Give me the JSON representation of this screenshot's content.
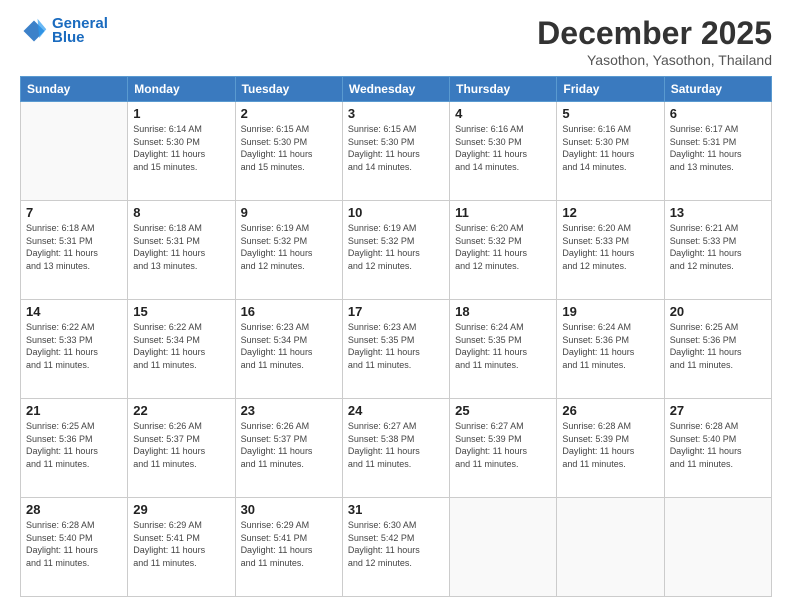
{
  "logo": {
    "line1": "General",
    "line2": "Blue"
  },
  "title": "December 2025",
  "subtitle": "Yasothon, Yasothon, Thailand",
  "days_header": [
    "Sunday",
    "Monday",
    "Tuesday",
    "Wednesday",
    "Thursday",
    "Friday",
    "Saturday"
  ],
  "weeks": [
    [
      {
        "day": "",
        "info": ""
      },
      {
        "day": "1",
        "info": "Sunrise: 6:14 AM\nSunset: 5:30 PM\nDaylight: 11 hours\nand 15 minutes."
      },
      {
        "day": "2",
        "info": "Sunrise: 6:15 AM\nSunset: 5:30 PM\nDaylight: 11 hours\nand 15 minutes."
      },
      {
        "day": "3",
        "info": "Sunrise: 6:15 AM\nSunset: 5:30 PM\nDaylight: 11 hours\nand 14 minutes."
      },
      {
        "day": "4",
        "info": "Sunrise: 6:16 AM\nSunset: 5:30 PM\nDaylight: 11 hours\nand 14 minutes."
      },
      {
        "day": "5",
        "info": "Sunrise: 6:16 AM\nSunset: 5:30 PM\nDaylight: 11 hours\nand 14 minutes."
      },
      {
        "day": "6",
        "info": "Sunrise: 6:17 AM\nSunset: 5:31 PM\nDaylight: 11 hours\nand 13 minutes."
      }
    ],
    [
      {
        "day": "7",
        "info": "Sunrise: 6:18 AM\nSunset: 5:31 PM\nDaylight: 11 hours\nand 13 minutes."
      },
      {
        "day": "8",
        "info": "Sunrise: 6:18 AM\nSunset: 5:31 PM\nDaylight: 11 hours\nand 13 minutes."
      },
      {
        "day": "9",
        "info": "Sunrise: 6:19 AM\nSunset: 5:32 PM\nDaylight: 11 hours\nand 12 minutes."
      },
      {
        "day": "10",
        "info": "Sunrise: 6:19 AM\nSunset: 5:32 PM\nDaylight: 11 hours\nand 12 minutes."
      },
      {
        "day": "11",
        "info": "Sunrise: 6:20 AM\nSunset: 5:32 PM\nDaylight: 11 hours\nand 12 minutes."
      },
      {
        "day": "12",
        "info": "Sunrise: 6:20 AM\nSunset: 5:33 PM\nDaylight: 11 hours\nand 12 minutes."
      },
      {
        "day": "13",
        "info": "Sunrise: 6:21 AM\nSunset: 5:33 PM\nDaylight: 11 hours\nand 12 minutes."
      }
    ],
    [
      {
        "day": "14",
        "info": "Sunrise: 6:22 AM\nSunset: 5:33 PM\nDaylight: 11 hours\nand 11 minutes."
      },
      {
        "day": "15",
        "info": "Sunrise: 6:22 AM\nSunset: 5:34 PM\nDaylight: 11 hours\nand 11 minutes."
      },
      {
        "day": "16",
        "info": "Sunrise: 6:23 AM\nSunset: 5:34 PM\nDaylight: 11 hours\nand 11 minutes."
      },
      {
        "day": "17",
        "info": "Sunrise: 6:23 AM\nSunset: 5:35 PM\nDaylight: 11 hours\nand 11 minutes."
      },
      {
        "day": "18",
        "info": "Sunrise: 6:24 AM\nSunset: 5:35 PM\nDaylight: 11 hours\nand 11 minutes."
      },
      {
        "day": "19",
        "info": "Sunrise: 6:24 AM\nSunset: 5:36 PM\nDaylight: 11 hours\nand 11 minutes."
      },
      {
        "day": "20",
        "info": "Sunrise: 6:25 AM\nSunset: 5:36 PM\nDaylight: 11 hours\nand 11 minutes."
      }
    ],
    [
      {
        "day": "21",
        "info": "Sunrise: 6:25 AM\nSunset: 5:36 PM\nDaylight: 11 hours\nand 11 minutes."
      },
      {
        "day": "22",
        "info": "Sunrise: 6:26 AM\nSunset: 5:37 PM\nDaylight: 11 hours\nand 11 minutes."
      },
      {
        "day": "23",
        "info": "Sunrise: 6:26 AM\nSunset: 5:37 PM\nDaylight: 11 hours\nand 11 minutes."
      },
      {
        "day": "24",
        "info": "Sunrise: 6:27 AM\nSunset: 5:38 PM\nDaylight: 11 hours\nand 11 minutes."
      },
      {
        "day": "25",
        "info": "Sunrise: 6:27 AM\nSunset: 5:39 PM\nDaylight: 11 hours\nand 11 minutes."
      },
      {
        "day": "26",
        "info": "Sunrise: 6:28 AM\nSunset: 5:39 PM\nDaylight: 11 hours\nand 11 minutes."
      },
      {
        "day": "27",
        "info": "Sunrise: 6:28 AM\nSunset: 5:40 PM\nDaylight: 11 hours\nand 11 minutes."
      }
    ],
    [
      {
        "day": "28",
        "info": "Sunrise: 6:28 AM\nSunset: 5:40 PM\nDaylight: 11 hours\nand 11 minutes."
      },
      {
        "day": "29",
        "info": "Sunrise: 6:29 AM\nSunset: 5:41 PM\nDaylight: 11 hours\nand 11 minutes."
      },
      {
        "day": "30",
        "info": "Sunrise: 6:29 AM\nSunset: 5:41 PM\nDaylight: 11 hours\nand 11 minutes."
      },
      {
        "day": "31",
        "info": "Sunrise: 6:30 AM\nSunset: 5:42 PM\nDaylight: 11 hours\nand 12 minutes."
      },
      {
        "day": "",
        "info": ""
      },
      {
        "day": "",
        "info": ""
      },
      {
        "day": "",
        "info": ""
      }
    ]
  ]
}
